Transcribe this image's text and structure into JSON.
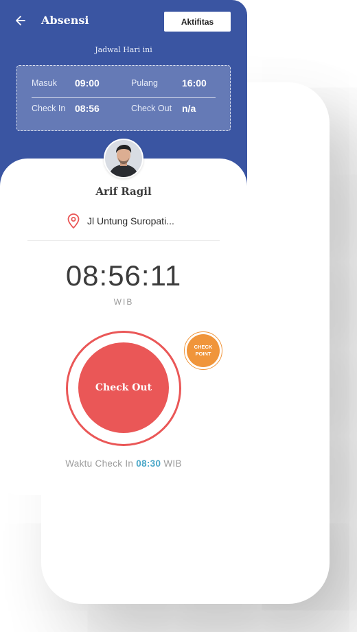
{
  "header": {
    "title": "Absensi",
    "activity_button": "Aktifitas"
  },
  "schedule": {
    "label": "Jadwal Hari ini",
    "masuk_label": "Masuk",
    "masuk_value": "09:00",
    "pulang_label": "Pulang",
    "pulang_value": "16:00",
    "checkin_label": "Check In",
    "checkin_value": "08:56",
    "checkout_label": "Check Out",
    "checkout_value": "n/a"
  },
  "user": {
    "name": "Arif Ragil",
    "location": "Jl Untung Suropati..."
  },
  "clock": {
    "time": "08:56:11",
    "timezone": "WIB"
  },
  "actions": {
    "checkout_button": "Check Out",
    "checkpoint_line1": "CHECK",
    "checkpoint_line2": "POINT"
  },
  "footer": {
    "prefix": "Waktu Check In",
    "time": "08:30",
    "suffix": "WIB"
  },
  "colors": {
    "header_blue": "#3a55a2",
    "checkout_red": "#ea5757",
    "checkpoint_orange": "#f0953b",
    "time_accent": "#4aa7c8"
  },
  "icons": {
    "back": "arrow-left-icon",
    "location": "map-pin-icon",
    "avatar": "user-avatar"
  }
}
